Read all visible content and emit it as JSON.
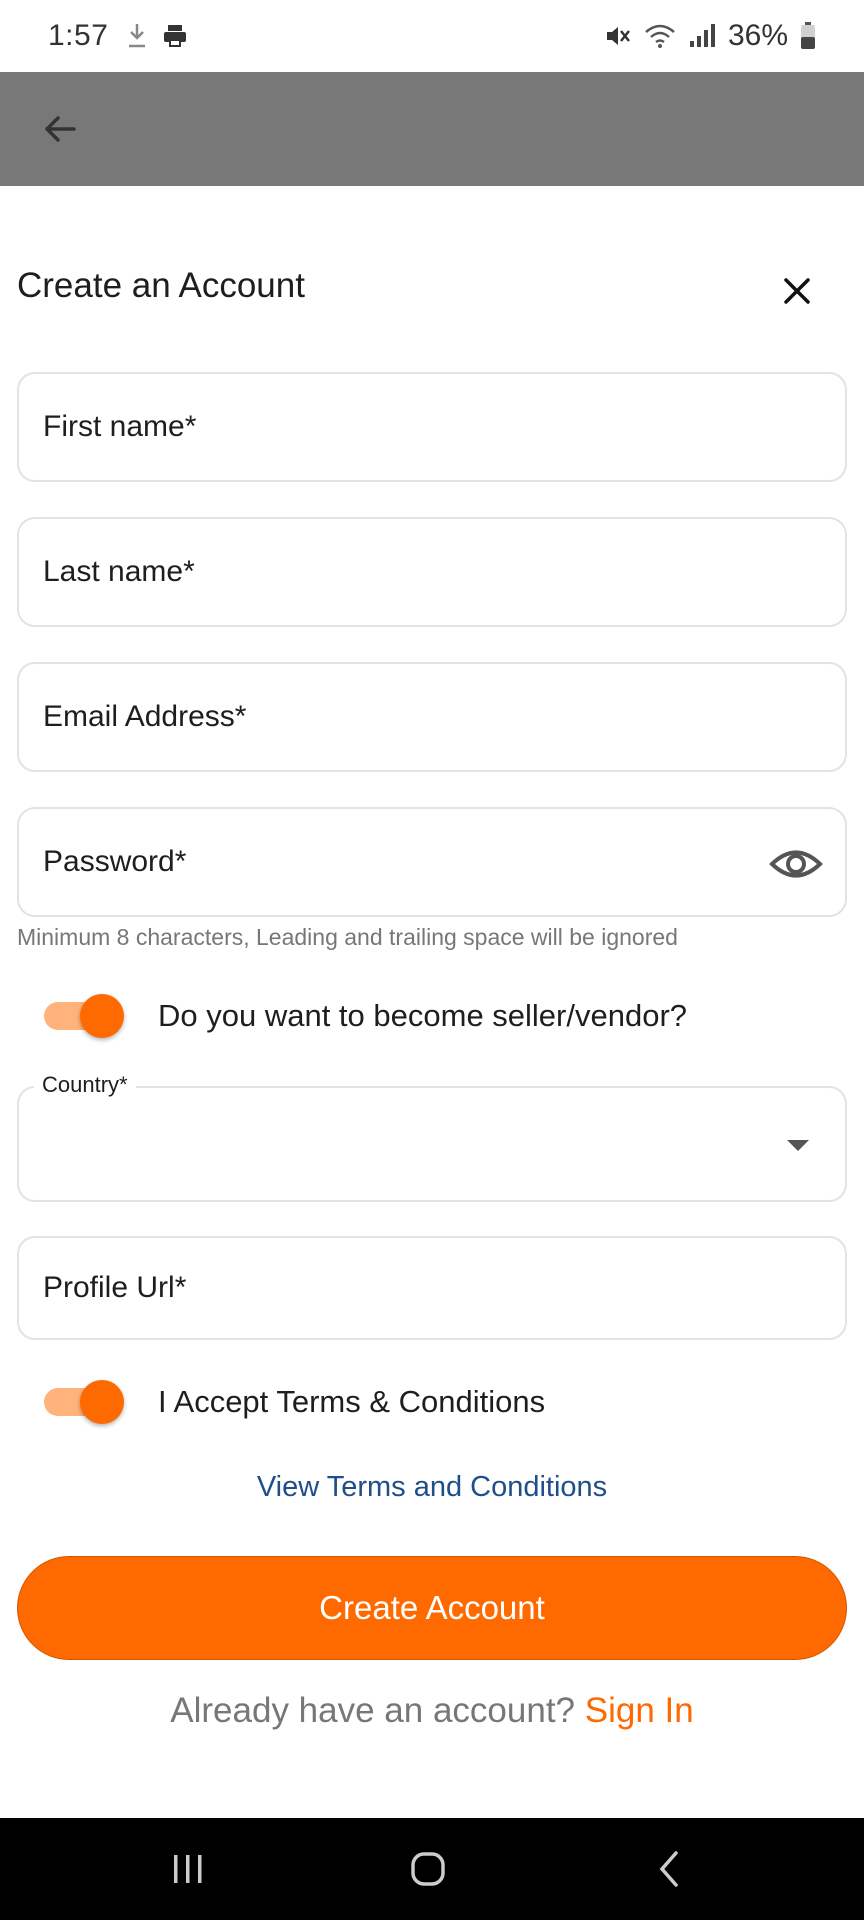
{
  "status_bar": {
    "time": "1:57",
    "battery": "36%"
  },
  "icons": {
    "back": "arrow-left-icon",
    "close": "close-icon",
    "eye": "eye-icon",
    "dropdown": "caret-down-icon"
  },
  "header": {
    "title": "Create an Account"
  },
  "form": {
    "first_name": "First name*",
    "last_name": "Last name*",
    "email": "Email Address*",
    "password": "Password*",
    "password_helper": "Minimum 8 characters, Leading and trailing space will be ignored",
    "seller_toggle_label": "Do you want to become seller/vendor?",
    "country_label": "Country*",
    "country_value": "",
    "profile_url": "Profile Url*",
    "terms_toggle_label": "I Accept Terms & Conditions",
    "view_terms": "View Terms and Conditions",
    "submit": "Create Account",
    "already_have": "Already have an account?",
    "sign_in": "Sign In"
  },
  "colors": {
    "accent": "#ff6a00",
    "app_bar": "#787878",
    "link": "#1f4e8a"
  }
}
